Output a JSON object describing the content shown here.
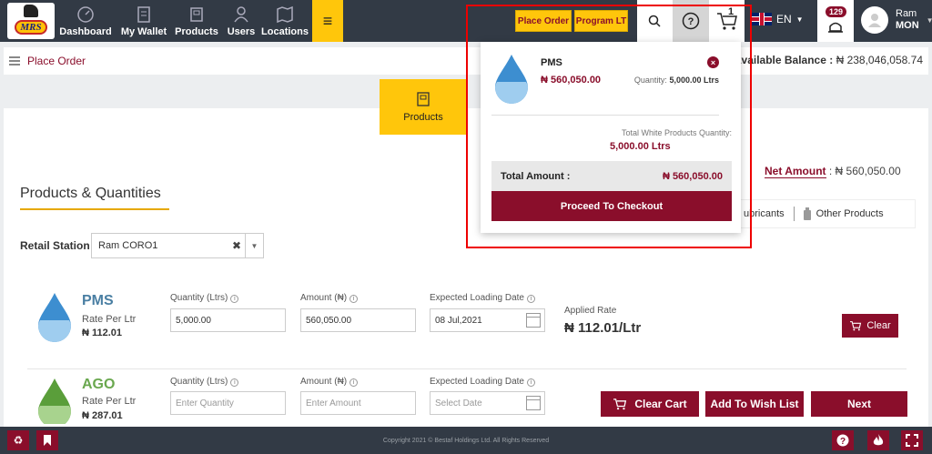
{
  "nav": {
    "items": [
      {
        "label": "Dashboard"
      },
      {
        "label": "My Wallet"
      },
      {
        "label": "Products"
      },
      {
        "label": "Users"
      },
      {
        "label": "Locations"
      }
    ],
    "place_order_label": "Place Order",
    "program_lt_label": "Program LT",
    "cart_count": "1",
    "language": "EN",
    "notification_count": "129",
    "user_name": "Ram",
    "user_sub": "MON"
  },
  "breadcrumb": {
    "label": "Place Order",
    "available_balance_label": "Available Balance :",
    "available_balance_value": "₦ 238,046,058.74"
  },
  "tabs": {
    "products": "Products"
  },
  "section": {
    "title": "Products & Quantities",
    "net_amount_label": "Net Amount",
    "net_amount_value": ": ₦ 560,050.00",
    "category_tabs": [
      "ubricants",
      "Other Products"
    ],
    "retail_station_label": "Retail Station",
    "retail_station_value": "Ram CORO1"
  },
  "products": [
    {
      "name": "PMS",
      "name_color": "#4a7fa3",
      "rate_label": "Rate Per Ltr",
      "rate_value": "₦ 112.01",
      "quantity_label": "Quantity (Ltrs)",
      "quantity_value": "5,000.00",
      "amount_label": "Amount (₦)",
      "amount_value": "560,050.00",
      "date_label": "Expected Loading Date",
      "date_value": "08 Jul,2021",
      "applied_rate_label": "Applied Rate",
      "applied_rate_value": "₦ 112.01/Ltr",
      "clear_label": "Clear"
    },
    {
      "name": "AGO",
      "name_color": "#6aa84f",
      "rate_label": "Rate Per Ltr",
      "rate_value": "₦ 287.01",
      "quantity_label": "Quantity (Ltrs)",
      "quantity_placeholder": "Enter Quantity",
      "amount_label": "Amount (₦)",
      "amount_placeholder": "Enter Amount",
      "date_label": "Expected Loading Date",
      "date_placeholder": "Select Date"
    }
  ],
  "actions": {
    "clear_cart": "Clear Cart",
    "add_to_wishlist": "Add To Wish List",
    "next": "Next"
  },
  "cart_dropdown": {
    "item_name": "PMS",
    "item_price": "₦ 560,050.00",
    "item_quantity_label": "Quantity:",
    "item_quantity_value": "5,000.00 Ltrs",
    "total_white_label": "Total White Products Quantity:",
    "total_white_value": "5,000.00 Ltrs",
    "total_amount_label": "Total Amount :",
    "total_amount_value": "₦ 560,050.00",
    "checkout_label": "Proceed To Checkout"
  },
  "footer": {
    "copyright": "Copyright 2021 © Bestaf Holdings Ltd. All Rights Reserved"
  },
  "colors": {
    "brand": "#8a0e2b",
    "accent": "#ffc60b",
    "nav_bg": "#323a45"
  }
}
